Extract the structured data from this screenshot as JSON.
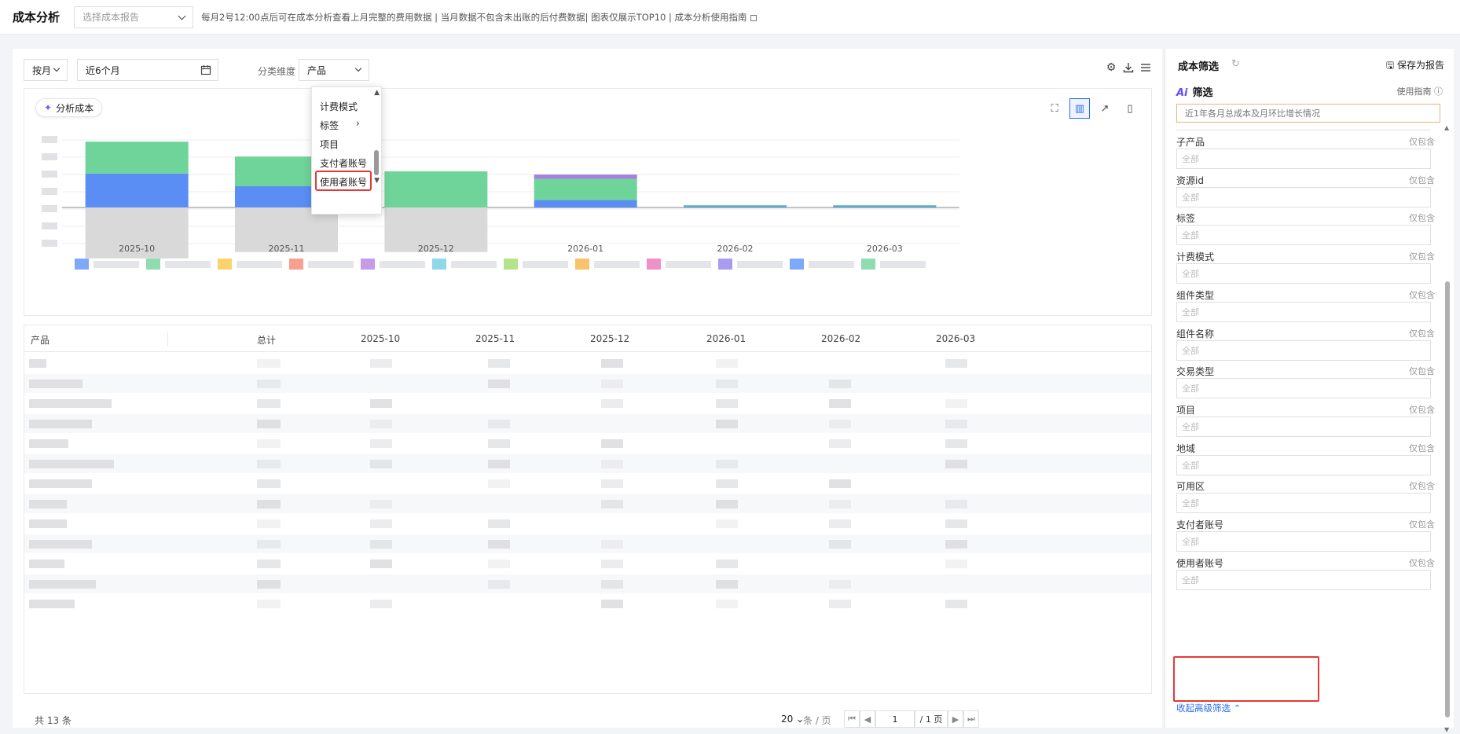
{
  "topbar": {
    "title": "成本分析",
    "report_placeholder": "选择成本报告",
    "notice": "每月2号12:00点后可在成本分析查看上月完整的费用数据 | 当月数据不包含未出账的后付费数据| 图表仅展示TOP10 | 成本分析使用指南"
  },
  "controls": {
    "granularity": "按月",
    "date_range": "近6个月",
    "dimension_label": "分类维度",
    "dimension_value": "产品"
  },
  "dropdown": {
    "items": [
      "计费模式",
      "标签",
      "项目",
      "支付者账号",
      "使用者账号"
    ],
    "highlighted": "使用者账号"
  },
  "chart": {
    "ai_chip": "分析成本"
  },
  "chart_data": {
    "type": "bar",
    "categories": [
      "2025-10",
      "2025-11",
      "2025-12",
      "2026-01",
      "2026-02",
      "2026-03"
    ],
    "series": [
      {
        "values": [
          32,
          20,
          0,
          7,
          0.5,
          0.3
        ],
        "color": "#5a8ef5"
      },
      {
        "values": [
          30,
          28,
          34,
          20,
          0.2,
          0.2
        ],
        "color": "#6fd49a"
      },
      {
        "values": [
          0,
          0,
          0,
          4,
          0,
          0
        ],
        "color": "#a77fe0"
      },
      {
        "values": [
          -48,
          -42,
          -42,
          0,
          0,
          0
        ],
        "color": "#d9d9d9"
      }
    ],
    "stacked": true,
    "legend_placement": "bottom"
  },
  "table": {
    "headers": [
      "产品",
      "总计",
      "2025-10",
      "2025-11",
      "2025-12",
      "2026-01",
      "2026-02",
      "2026-03"
    ],
    "row_count": 13
  },
  "footer": {
    "total": "共 13 条",
    "page_size": "20",
    "page_size_unit": "条 / 页",
    "current_page": "1",
    "page_total": "/ 1 页"
  },
  "right_panel": {
    "title": "成本筛选",
    "save_report": "保存为报告",
    "ai_title": "筛选",
    "ai_logo": "Ai",
    "guide": "使用指南",
    "ai_input": "近1年各月总成本及月环比增长情况",
    "filters": [
      {
        "label": "子产品",
        "flag": "仅包含",
        "value": "全部"
      },
      {
        "label": "资源id",
        "flag": "仅包含",
        "value": "全部"
      },
      {
        "label": "标签",
        "flag": "仅包含",
        "value": "全部"
      },
      {
        "label": "计费模式",
        "flag": "仅包含",
        "value": "全部"
      },
      {
        "label": "组件类型",
        "flag": "仅包含",
        "value": "全部"
      },
      {
        "label": "组件名称",
        "flag": "仅包含",
        "value": "全部"
      },
      {
        "label": "交易类型",
        "flag": "仅包含",
        "value": "全部"
      },
      {
        "label": "项目",
        "flag": "仅包含",
        "value": "全部"
      },
      {
        "label": "地域",
        "flag": "仅包含",
        "value": "全部"
      },
      {
        "label": "可用区",
        "flag": "仅包含",
        "value": "全部"
      },
      {
        "label": "支付者账号",
        "flag": "仅包含",
        "value": "全部"
      },
      {
        "label": "使用者账号",
        "flag": "仅包含",
        "value": "全部"
      }
    ],
    "collapse": "收起高级筛选"
  }
}
